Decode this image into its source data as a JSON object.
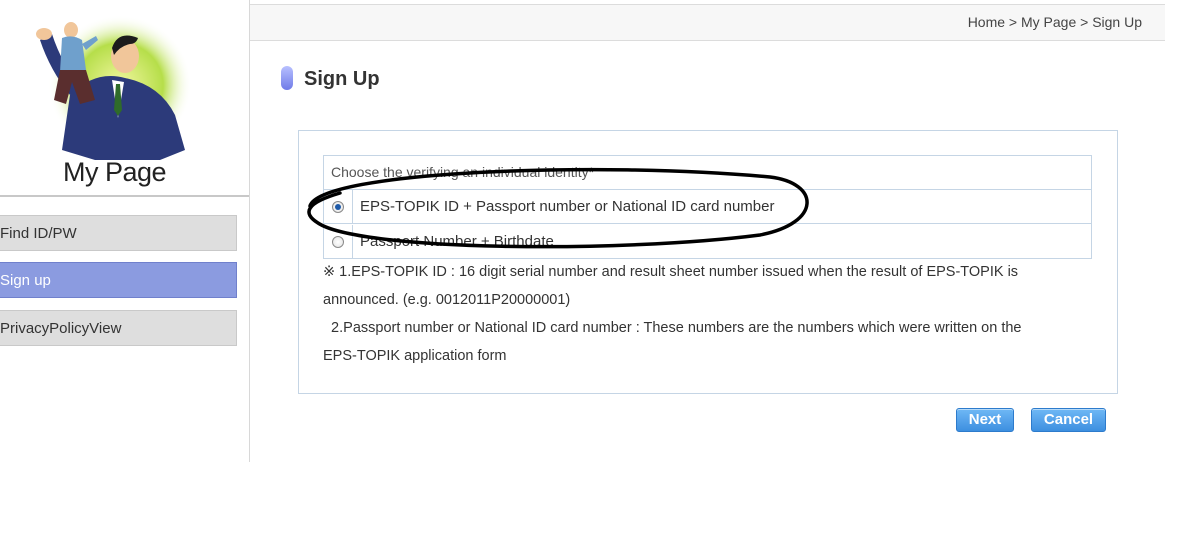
{
  "sidebar": {
    "hero_title": "My Page",
    "items": [
      {
        "label": "Find ID/PW",
        "active": false
      },
      {
        "label": "Sign up",
        "active": true
      },
      {
        "label": "PrivacyPolicyView",
        "active": false
      }
    ]
  },
  "header": {
    "breadcrumb": "Home > My Page > Sign Up"
  },
  "main": {
    "title": "Sign Up",
    "options_header": "Choose the verifying an individual identity*",
    "options": [
      {
        "label": "EPS-TOPIK ID + Passport number or National ID card number",
        "checked": true
      },
      {
        "label": "Passport Number + Birthdate",
        "checked": false
      }
    ],
    "notes": [
      "※ 1.EPS-TOPIK ID : 16 digit serial number and result sheet number issued when the result of EPS-TOPIK is",
      "announced. (e.g. 0012011P20000001)",
      "  2.Passport number or National ID card number : These numbers are the numbers which were written on the",
      "EPS-TOPIK application form"
    ]
  },
  "buttons": {
    "next": "Next",
    "cancel": "Cancel"
  },
  "colors": {
    "active_sidebar": "#8b9be0",
    "button_blue": "#4a9be6",
    "border": "#c5d5e5"
  }
}
